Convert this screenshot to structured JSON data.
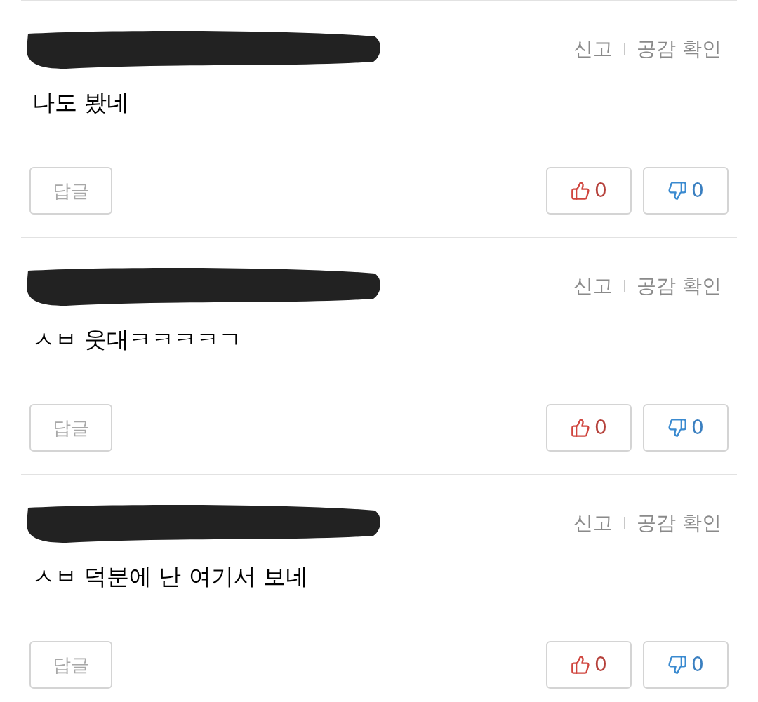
{
  "comments": [
    {
      "report": "신고",
      "empathy": "공감 확인",
      "text": "나도 봤네",
      "reply": "답글",
      "likes": "0",
      "dislikes": "0"
    },
    {
      "report": "신고",
      "empathy": "공감 확인",
      "text": "ㅅㅂ 웃대ㅋㅋㅋㅋㄱ",
      "reply": "답글",
      "likes": "0",
      "dislikes": "0"
    },
    {
      "report": "신고",
      "empathy": "공감 확인",
      "text": "ㅅㅂ 덕분에 난 여기서 보네",
      "reply": "답글",
      "likes": "0",
      "dislikes": "0"
    }
  ]
}
